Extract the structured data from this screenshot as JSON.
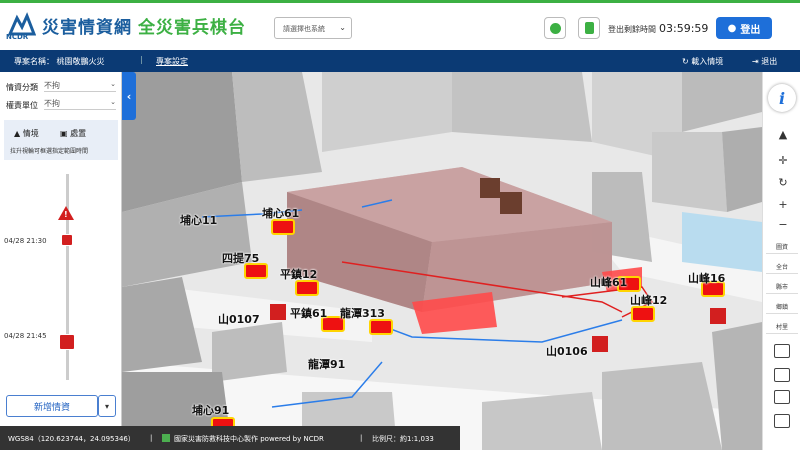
{
  "header": {
    "title": "災害情資網",
    "subtitle": "全災害兵棋台",
    "ncdr": "NCDR",
    "select_value": "請選擇也系統",
    "session_label": "登出剩餘時間",
    "session_time": "03:59:59",
    "logout_label": "登出"
  },
  "project_bar": {
    "project": "專案名稱：  桃園敬鵬火災",
    "separator": "|",
    "settings": "專案設定",
    "enter": "載入情境",
    "exit": "退出"
  },
  "left_panel": {
    "filter_category_label": "情資分類",
    "filter_category_value": "不拘",
    "filter_unit_label": "權責單位",
    "filter_unit_value": "不拘",
    "tab_situation": "情境",
    "tab_handling": "處置",
    "hint": "拉升視輪可框選指定範圍時間",
    "timeline": [
      {
        "time": "04/28 21:30"
      },
      {
        "time": "04/28 21:45"
      }
    ],
    "add_button": "新增情資"
  },
  "map": {
    "labels": [
      {
        "text": "埔心11"
      },
      {
        "text": "埔心61"
      },
      {
        "text": "四提75"
      },
      {
        "text": "平鎮12"
      },
      {
        "text": "山0107"
      },
      {
        "text": "平鎮61"
      },
      {
        "text": "龍潭313"
      },
      {
        "text": "龍潭91"
      },
      {
        "text": "埔心91"
      },
      {
        "text": "山峰61"
      },
      {
        "text": "山峰16"
      },
      {
        "text": "山峰12"
      },
      {
        "text": "山0106"
      }
    ]
  },
  "right_toolbar": {
    "info": "i",
    "text_buttons": [
      "圖資",
      "全台",
      "縣市",
      "鄉鎮",
      "村里"
    ]
  },
  "status_bar": {
    "coords": "WGS84（120.623744，24.095346）",
    "credit": "國家災害防救科技中心製作 powered by NCDR",
    "separator": "|",
    "scale": "比例尺：約1:1,033"
  },
  "colors": {
    "primary": "#1e6fd9",
    "navy": "#0b3a74",
    "green": "#3cb043",
    "alert": "#d21f1f"
  }
}
